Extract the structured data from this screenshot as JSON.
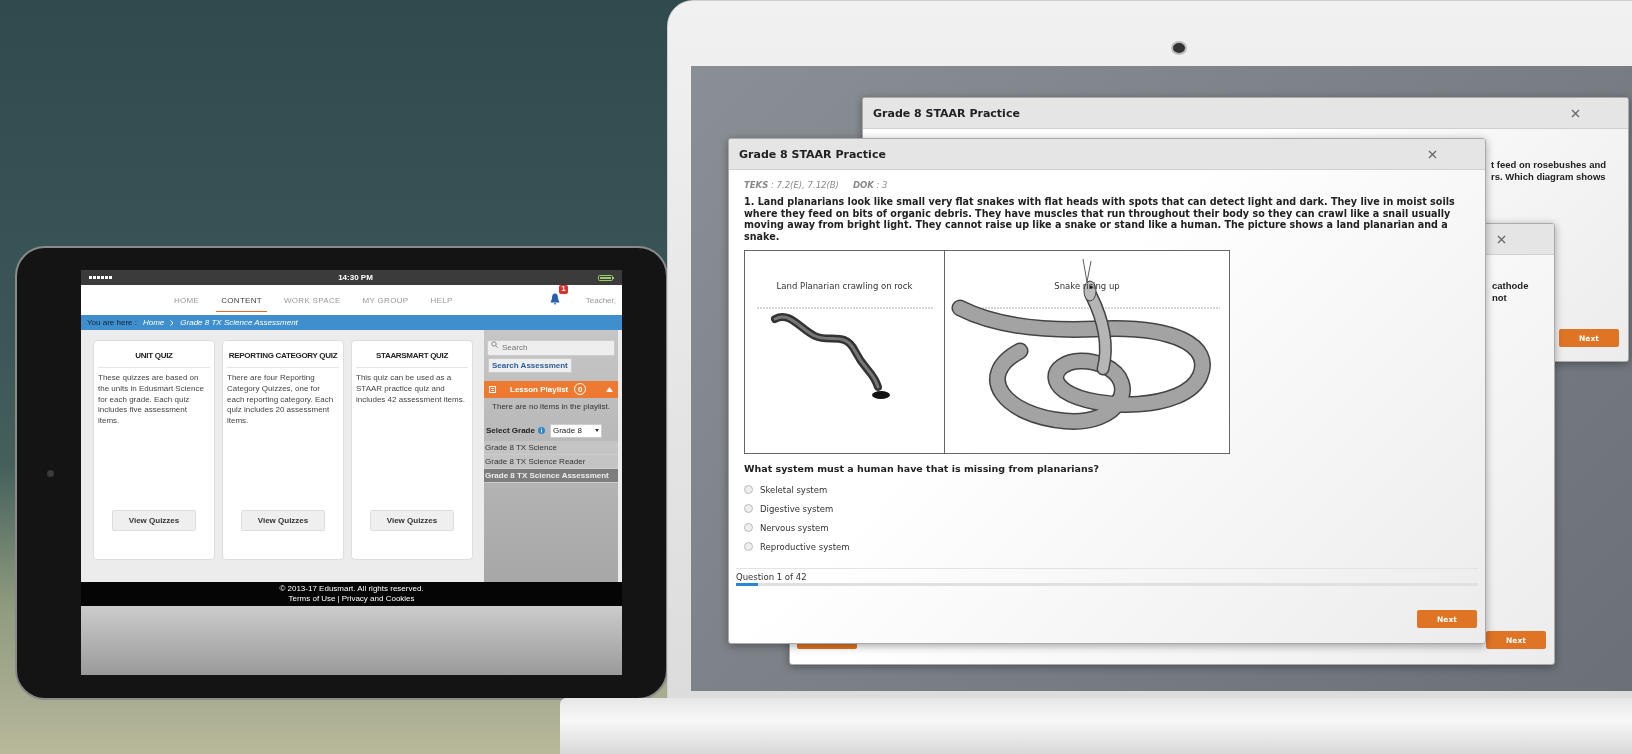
{
  "tablet": {
    "status_bar": {
      "time": "14:30 PM"
    },
    "nav": [
      {
        "label": "HOME",
        "selected": false
      },
      {
        "label": "CONTENT",
        "selected": true
      },
      {
        "label": "WORK SPACE",
        "selected": false
      },
      {
        "label": "MY GROUP",
        "selected": false
      },
      {
        "label": "HELP",
        "selected": false
      }
    ],
    "notification_count": "1",
    "user": "Teacher,",
    "breadcrumb": {
      "label": "You are here :",
      "items": [
        "Home",
        "Grade 8 TX Science Assessment"
      ]
    },
    "cards": [
      {
        "title": "UNIT QUIZ",
        "description": "These quizzes are based on the units in Edusmart Science for each grade. Each quiz includes five assessment items.",
        "button": "View Quizzes"
      },
      {
        "title": "REPORTING CATEGORY QUIZ",
        "description": "There are four Reporting Category Quizzes, one for each reporting category. Each quiz includes 20 assessment items.",
        "button": "View Quizzes"
      },
      {
        "title": "STAARSMART QUIZ",
        "description": "This quiz can be used as a STAAR practice quiz and includes 42 assessment items.",
        "button": "View Quizzes"
      }
    ],
    "sidebar": {
      "search": {
        "placeholder": "Search"
      },
      "search_button": "Search Assessment",
      "playlist": {
        "title": "Lesson Playlist",
        "count": "0",
        "expanded": true,
        "empty_message": "There are no items in the playlist."
      },
      "grade_select": {
        "label": "Select Grade",
        "value": "Grade 8"
      },
      "courses": [
        {
          "label": "Grade 8 TX Science",
          "selected": false
        },
        {
          "label": "Grade 8 TX Science Reader",
          "selected": false
        },
        {
          "label": "Grade 8 TX Science Assessment",
          "selected": true
        }
      ]
    },
    "footer": {
      "copyright": "© 2013-17 Edusmart. All rights reserved.",
      "links": [
        "Terms of Use",
        "Privacy and Cookies"
      ],
      "separator": "|"
    }
  },
  "laptop": {
    "back_dialogs": [
      {
        "title": "Grade 8 STAAR Practice",
        "lines": [
          "t feed on rosebushes and",
          "rs. Which diagram shows"
        ],
        "buttons": [
          {
            "kind": "next",
            "label": "Next"
          }
        ]
      },
      {
        "lines": [
          "cathode",
          "not"
        ],
        "buttons": [
          {
            "kind": "previous"
          },
          {
            "kind": "next",
            "label": "Next"
          }
        ]
      }
    ],
    "dialog": {
      "title": "Grade 8 STAAR Practice",
      "teks": "**TEKS** : 7.2(E), 7.12(B)",
      "dok": "**DOK** : 3",
      "question": "1. Land planarians look like small very flat snakes with flat heads with spots that can detect light and dark. They live in moist soils where they feed on bits of organic debris. They have muscles that run throughout their body so they can crawl like a snail usually moving away from bright light. They cannot raise up like a snake or stand like a human. The picture shows a land planarian and a snake.",
      "figure": [
        {
          "kind": "planarian",
          "caption": "Land Planarian crawling on rock"
        },
        {
          "kind": "snake",
          "caption": "Snake rising up"
        }
      ],
      "prompt": "What system must a human have that is missing from planarians?",
      "options": [
        {
          "label": "Skeletal system",
          "selected": false
        },
        {
          "label": "Digestive system",
          "selected": false
        },
        {
          "label": "Nervous system",
          "selected": false
        },
        {
          "label": "Reproductive system",
          "selected": false
        }
      ],
      "progress": {
        "label": "Question 1 of 42",
        "level": 0.03
      },
      "next": "Next"
    }
  }
}
